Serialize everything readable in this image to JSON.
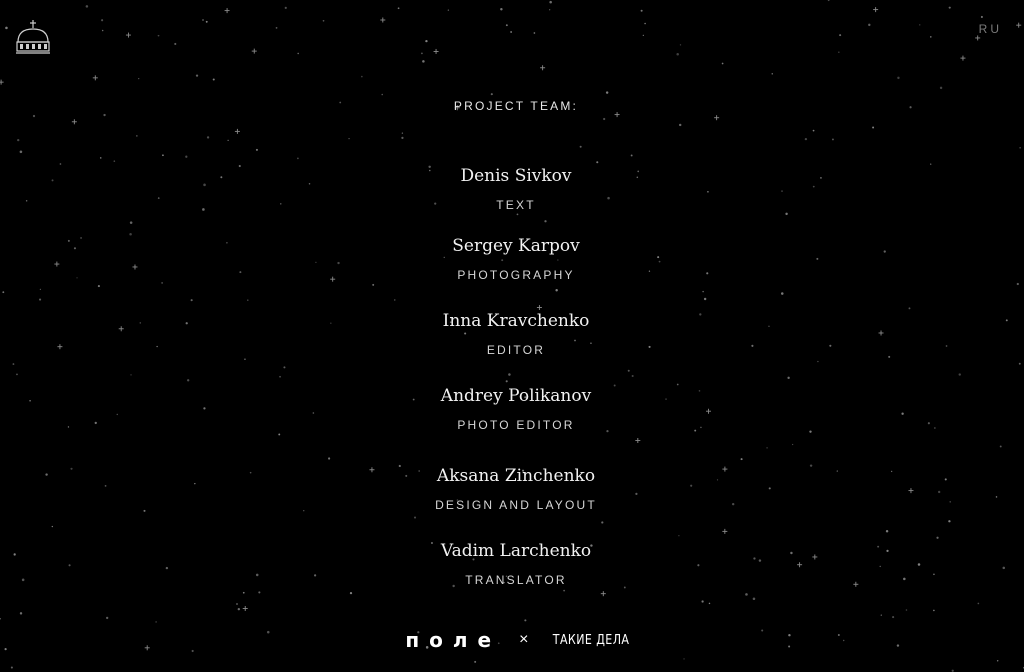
{
  "header": {
    "logo_icon": "church-dome-icon",
    "language_switch": "RU"
  },
  "team": {
    "heading": "PROJECT TEAM:",
    "members": [
      {
        "name": "Denis Sivkov",
        "role": "TEXT"
      },
      {
        "name": "Sergey Karpov",
        "role": "PHOTOGRAPHY"
      },
      {
        "name": "Inna Kravchenko",
        "role": "EDITOR"
      },
      {
        "name": "Andrey Polikanov",
        "role": "PHOTO EDITOR"
      },
      {
        "name": "Aksana Zinchenko",
        "role": "DESIGN AND LAYOUT"
      },
      {
        "name": "Vadim Larchenko",
        "role": "TRANSLATOR"
      }
    ]
  },
  "footer": {
    "partner_one": "поле",
    "separator": "×",
    "partner_two": "ТАКИЕ ДЕЛА"
  },
  "colors": {
    "background": "#000000",
    "text": "#ffffff",
    "muted": "#7a7a7a",
    "star": "#8c8c8c"
  }
}
